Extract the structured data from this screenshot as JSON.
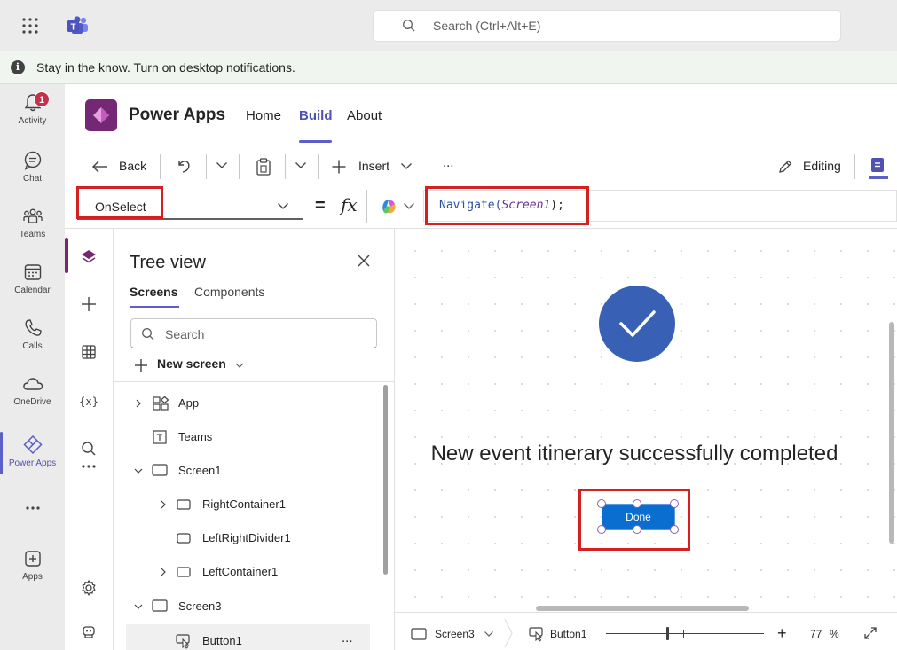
{
  "search": {
    "placeholder": "Search (Ctrl+Alt+E)"
  },
  "notification": {
    "text": "Stay in the know. Turn on desktop notifications.",
    "icon": "info-icon"
  },
  "rail": {
    "badge": "1",
    "items": [
      {
        "label": "Activity",
        "icon": "bell-icon"
      },
      {
        "label": "Chat",
        "icon": "chat-icon"
      },
      {
        "label": "Teams",
        "icon": "teams-icon"
      },
      {
        "label": "Calendar",
        "icon": "calendar-icon"
      },
      {
        "label": "Calls",
        "icon": "phone-icon"
      },
      {
        "label": "OneDrive",
        "icon": "cloud-icon"
      },
      {
        "label": "Power Apps",
        "icon": "powerapps-icon"
      },
      {
        "label": "Apps",
        "icon": "add-apps-icon"
      }
    ]
  },
  "app": {
    "title": "Power Apps",
    "tabs": [
      "Home",
      "Build",
      "About"
    ],
    "active_tab": "Build"
  },
  "command_bar": {
    "back": "Back",
    "insert": "Insert",
    "more": "...",
    "editing": "Editing"
  },
  "formula_bar": {
    "property": "OnSelect",
    "fx": "fx",
    "equals": "=",
    "formula_func": "Navigate",
    "formula_arg": "Screen1",
    "formula_end": ");"
  },
  "tree": {
    "title": "Tree view",
    "tabs": [
      "Screens",
      "Components"
    ],
    "search_placeholder": "Search",
    "new_screen": "New screen",
    "nodes": [
      "App",
      "Teams",
      "Screen1",
      "RightContainer1",
      "LeftRightDivider1",
      "LeftContainer1",
      "Screen3",
      "Button1"
    ],
    "more": "..."
  },
  "canvas": {
    "message": "New event itinerary successfully completed",
    "button": "Done"
  },
  "status": {
    "screen": "Screen3",
    "control": "Button1",
    "zoom": "77",
    "zoom_unit": "%",
    "zoom_plus": "+"
  },
  "colors": {
    "accent": "#5b5fc7",
    "powerapps": "#742774",
    "done_button": "#0a6ed1",
    "check_circle": "#3860b4",
    "highlight": "#d42020"
  }
}
